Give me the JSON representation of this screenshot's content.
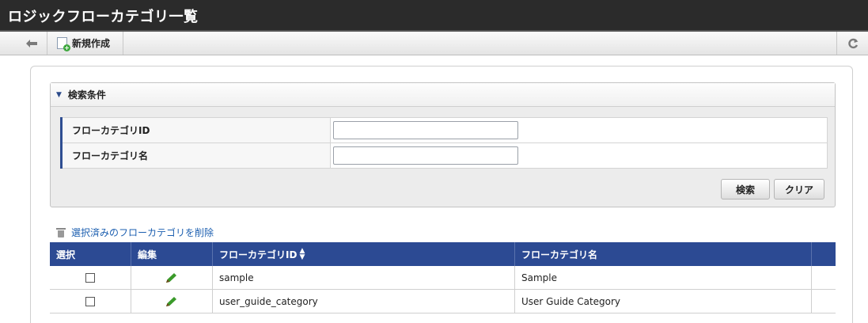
{
  "header": {
    "title": "ロジックフローカテゴリ一覧"
  },
  "toolbar": {
    "back_icon": "back-arrow-icon",
    "new_label": "新規作成",
    "new_icon": "new-document-icon",
    "refresh_icon": "refresh-icon"
  },
  "search": {
    "title": "検索条件",
    "fields": [
      {
        "label": "フローカテゴリID",
        "value": ""
      },
      {
        "label": "フローカテゴリ名",
        "value": ""
      }
    ],
    "search_button": "検索",
    "clear_button": "クリア"
  },
  "actions": {
    "delete_selected": "選択済みのフローカテゴリを削除"
  },
  "grid": {
    "columns": [
      "選択",
      "編集",
      "フローカテゴリID",
      "フローカテゴリ名"
    ],
    "rows": [
      {
        "id": "sample",
        "name": "Sample"
      },
      {
        "id": "user_guide_category",
        "name": "User Guide Category"
      }
    ]
  },
  "colors": {
    "header_bg": "#2b2b2b",
    "grid_header": "#2c4a93",
    "link": "#1c5fb0",
    "edit_pencil": "#3a9a2a"
  }
}
